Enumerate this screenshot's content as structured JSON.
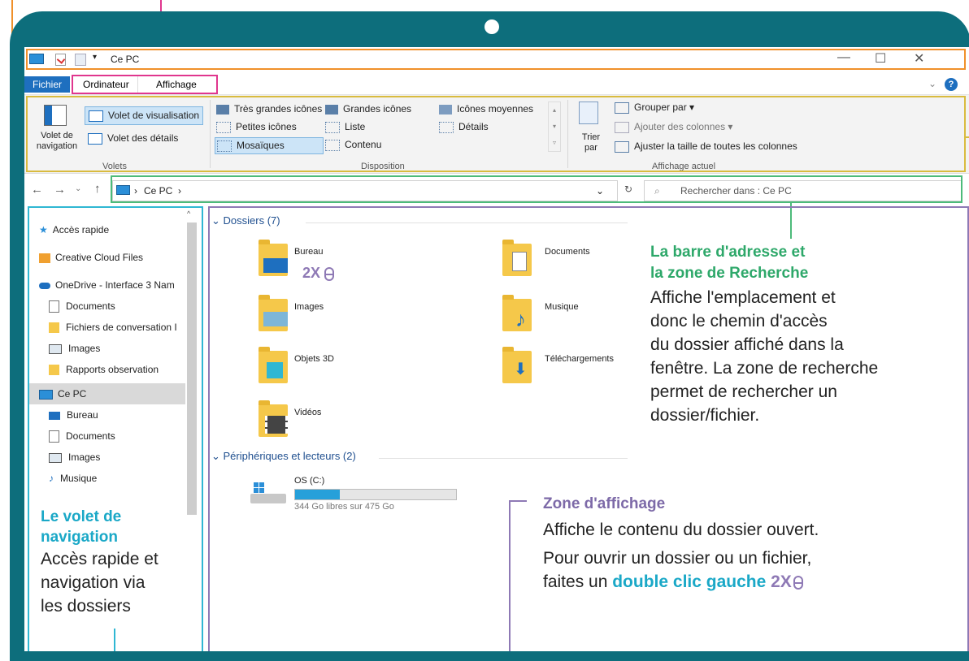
{
  "window": {
    "title": "Ce PC",
    "minimize_icon": "minimize-icon",
    "maximize_icon": "maximize-icon",
    "close_icon": "close-icon"
  },
  "ribbon_tabs": {
    "file": "Fichier",
    "computer": "Ordinateur",
    "view": "Affichage"
  },
  "ribbon": {
    "panes": {
      "nav_pane": "Volet de navigation",
      "preview_pane": "Volet de visualisation",
      "details_pane": "Volet des détails",
      "group_label": "Volets"
    },
    "layout": {
      "items": [
        "Très grandes icônes",
        "Grandes icônes",
        "Icônes moyennes",
        "Petites icônes",
        "Liste",
        "Détails",
        "Mosaïques",
        "Contenu"
      ],
      "group_label": "Disposition"
    },
    "current_view": {
      "sort_by": "Trier par",
      "group_by": "Grouper par",
      "add_columns": "Ajouter des colonnes",
      "fit_columns": "Ajuster la taille de toutes les colonnes",
      "group_label": "Affichage actuel"
    }
  },
  "address": {
    "path": "Ce PC",
    "search_placeholder": "Rechercher dans : Ce PC"
  },
  "nav_pane": {
    "items": [
      "Accès rapide",
      "Creative Cloud Files",
      "OneDrive - Interface 3 Nam",
      "Documents",
      "Fichiers de conversation I",
      "Images",
      "Rapports observation",
      "Ce PC",
      "Bureau",
      "Documents",
      "Images",
      "Musique"
    ]
  },
  "content": {
    "folders_header": "Dossiers (7)",
    "folders": [
      "Bureau",
      "Documents",
      "Images",
      "Musique",
      "Objets 3D",
      "Téléchargements",
      "Vidéos"
    ],
    "devices_header": "Périphériques et lecteurs (2)",
    "drive": {
      "name": "OS (C:)",
      "free": "344 Go libres sur 475 Go",
      "used_fraction": 0.28
    },
    "double_click_badge": "2X"
  },
  "callouts": {
    "address": {
      "title_line1": "La barre d'adresse et",
      "title_line2": "la zone de Recherche",
      "body": [
        "Affiche l'emplacement et",
        "donc le chemin d'accès",
        "du dossier affiché dans la",
        "fenêtre. La zone de recherche",
        "permet de rechercher un",
        "dossier/fichier."
      ]
    },
    "display": {
      "title": "Zone d'affichage",
      "line1": "Affiche le contenu du dossier ouvert.",
      "line2": "Pour ouvrir un dossier ou un fichier,",
      "line3_prefix": "faites un",
      "line3_bold": "double clic gauche",
      "line3_badge": "2X"
    },
    "navpane": {
      "title_line1": "Le volet de",
      "title_line2": "navigation",
      "body": [
        "Accès rapide et",
        "navigation via",
        "les dossiers"
      ]
    }
  },
  "colors": {
    "frame": "#0d6e7c",
    "accent_blue": "#1e6fbf",
    "callout_green": "#2ea86a",
    "callout_purple": "#7d6aa8",
    "callout_cyan": "#1aa8c7"
  }
}
